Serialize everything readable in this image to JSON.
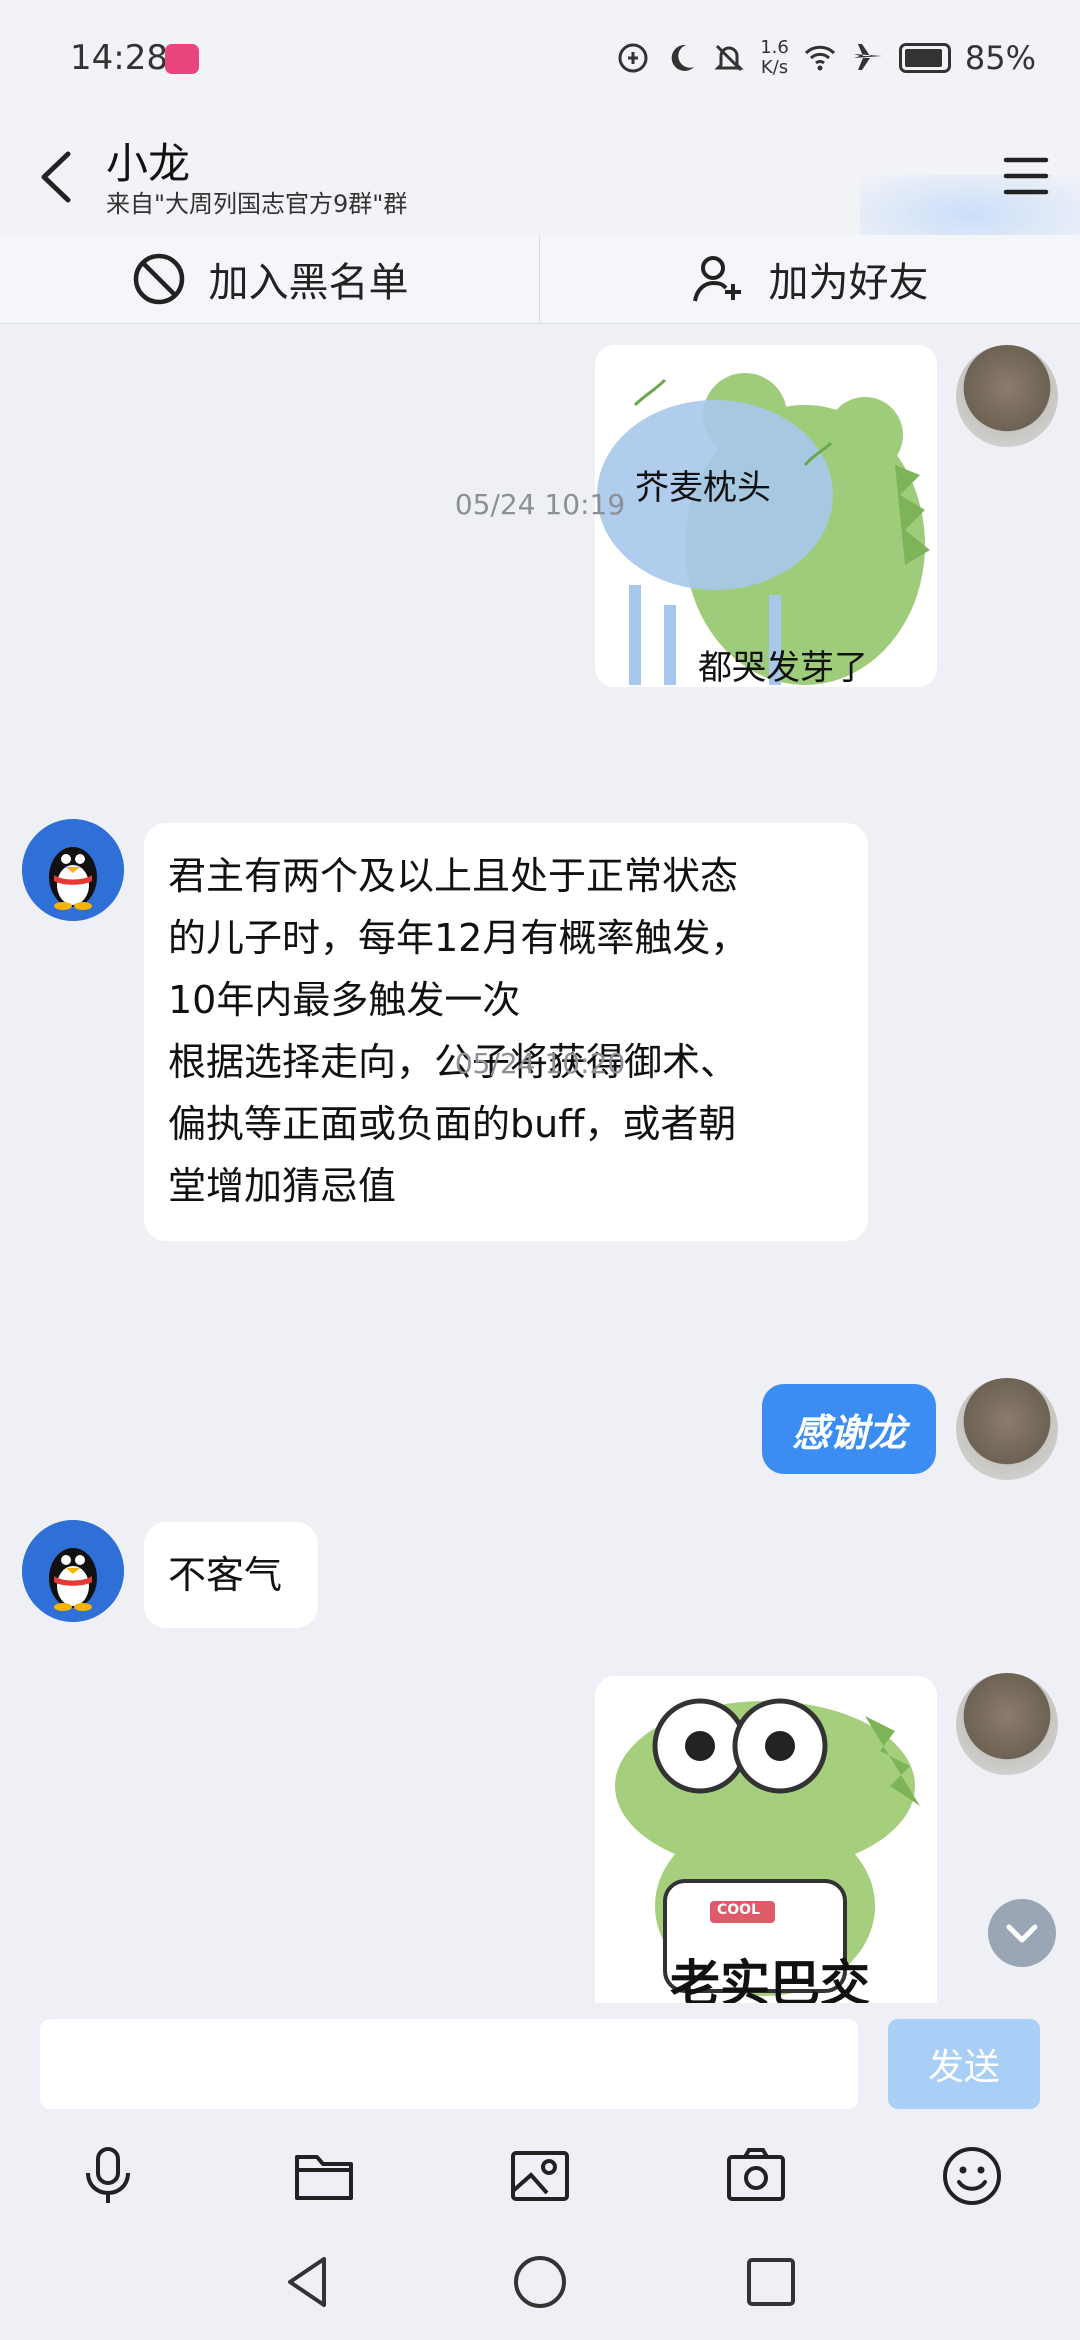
{
  "status_bar": {
    "time": "14:28",
    "net_speed_value": "1.6",
    "net_speed_unit": "K/s",
    "battery": "85%",
    "icons": [
      "app-badge-icon",
      "data-saver-icon",
      "moon-icon",
      "bell-off-icon",
      "wifi-icon",
      "airplane-icon",
      "battery-icon"
    ]
  },
  "header": {
    "title": "小龙",
    "subtitle": "来自\"大周列国志官方9群\"群"
  },
  "actions": {
    "blacklist_label": "加入黑名单",
    "add_friend_label": "加为好友"
  },
  "messages": {
    "sticker1_caption_top": "芥麦枕头",
    "sticker1_caption_bottom": "都哭发芽了",
    "timestamp1": "05/24 10:19",
    "incoming1": [
      "君主有两个及以上且处于正常状态",
      "的儿子时，每年12月有概率触发，",
      "10年内最多触发一次",
      "根据选择走向，公子将获得御术、",
      "偏执等正面或负面的buff，或者朝",
      "堂增加猜忌值"
    ],
    "timestamp2": "05/24 10:20",
    "outgoing1": "感谢龙",
    "incoming2": "不客气",
    "sticker2_badge": "COOL",
    "sticker2_caption": "老实巴交"
  },
  "input": {
    "value": "",
    "send_label": "发送"
  },
  "colors": {
    "background": "#eef0f5",
    "accent_blue": "#3b8df2",
    "send_disabled": "#a9cff7"
  }
}
